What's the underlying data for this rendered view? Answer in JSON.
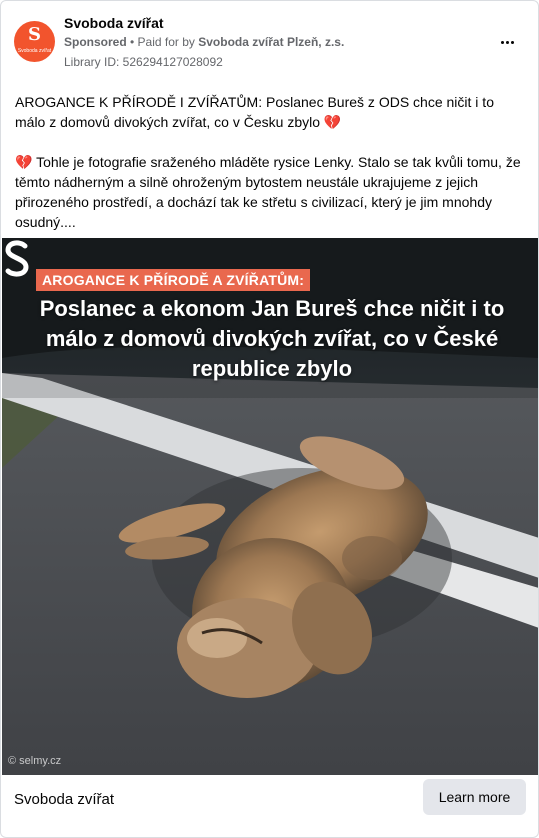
{
  "post": {
    "page_name": "Svoboda zvířat",
    "sponsored_label": "Sponsored",
    "separator": " • ",
    "paid_for_prefix": "Paid for by ",
    "paid_for_by": "Svoboda zvířat Plzeň, z.s.",
    "library_id": "Library ID: 526294127028092",
    "avatar": {
      "letter": "S",
      "caption": "Svoboda zvířat",
      "color": "#f2542d"
    },
    "more_icon": "more-horizontal-icon"
  },
  "body": {
    "paragraph1_text": "AROGANCE K PŘÍRODĚ I ZVÍŘATŮM: Poslanec Bureš z ODS chce ničit i to málo z domovů divokých zvířat, co v Česku zbylo ",
    "paragraph1_emoji": "💔",
    "paragraph2_emoji": "💔",
    "paragraph2_text": " Tohle je fotografie sraženého mláděte rysice Lenky. Stalo se tak kvůli tomu, že těmto nádherným a silně ohroženým bytostem neustále ukrajujeme z jejich přirozeného prostředí, a dochází tak ke střetu s civilizací, který je jim mnohdy osudný...."
  },
  "media": {
    "banner_tag": "AROGANCE K PŘÍRODĚ A ZVÍŘATŮM:",
    "headline": "Poslanec a ekonom Jan Bureš chce ničit i to málo z domovů divokých zvířat, co v České republice zbylo",
    "watermark": "© selmy.cz",
    "tag_color": "#e9684e"
  },
  "footer": {
    "title": "Svoboda zvířat",
    "cta_label": "Learn more"
  }
}
